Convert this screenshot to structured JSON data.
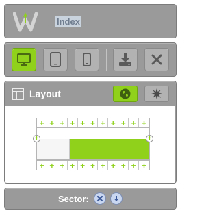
{
  "header": {
    "title": "Index",
    "logo_icon": "w-logo-icon"
  },
  "toolbar": {
    "buttons": [
      {
        "icon": "desktop-icon",
        "active": true
      },
      {
        "icon": "tablet-icon",
        "active": false
      },
      {
        "icon": "mobile-icon",
        "active": false
      },
      {
        "icon": "download-icon",
        "active": false
      },
      {
        "icon": "close-icon",
        "active": false
      }
    ]
  },
  "layout": {
    "title": "Layout",
    "icon": "layout-icon",
    "actions": [
      {
        "icon": "globe-icon",
        "active": true
      },
      {
        "icon": "burst-icon",
        "active": false
      }
    ],
    "plus_glyph": "+",
    "columns": 12
  },
  "sector": {
    "label": "Sector:",
    "actions": [
      {
        "icon": "remove-icon"
      },
      {
        "icon": "move-down-icon"
      }
    ]
  },
  "colors": {
    "accent": "#8fd11b",
    "panel": "#9a9a9a",
    "button": "#b2b2b2",
    "round_button": "#c9d7f0",
    "round_button_icon": "#3d5a99"
  }
}
